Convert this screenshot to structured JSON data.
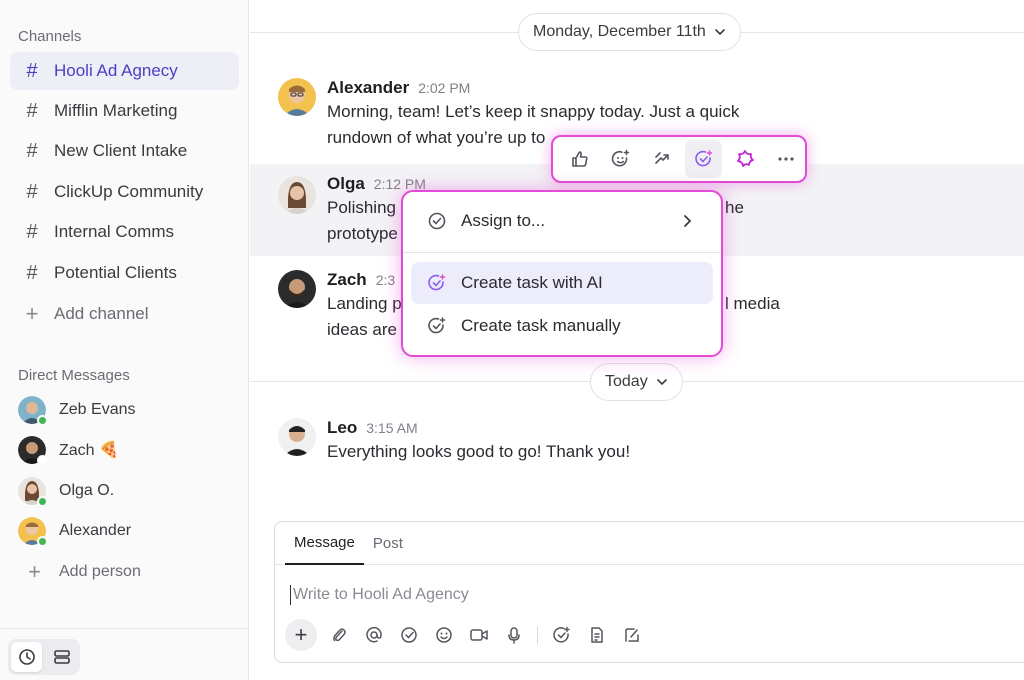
{
  "sidebar": {
    "channels_title": "Channels",
    "channels": [
      {
        "label": "Hooli Ad Agnecy",
        "active": true
      },
      {
        "label": "Mifflin Marketing"
      },
      {
        "label": "New Client Intake"
      },
      {
        "label": "ClickUp Community"
      },
      {
        "label": "Internal Comms"
      },
      {
        "label": "Potential Clients"
      }
    ],
    "add_channel": "Add channel",
    "dm_title": "Direct Messages",
    "dms": [
      {
        "label": "Zeb Evans"
      },
      {
        "label": "Zach 🍕"
      },
      {
        "label": "Olga O."
      },
      {
        "label": "Alexander"
      }
    ],
    "add_person": "Add person"
  },
  "main": {
    "date_divider": "Monday, December 11th",
    "today_divider": "Today",
    "messages": [
      {
        "author": "Alexander",
        "time": "2:02 PM",
        "line1": "Morning, team! Let’s keep it snappy today. Just a quick",
        "line2": "rundown of what you’re up to"
      },
      {
        "author": "Olga",
        "time": "2:12 PM",
        "line1": "Polishing",
        "line1_end": "he",
        "line2": "prototype"
      },
      {
        "author": "Zach",
        "time": "2:3",
        "line1": "Landing p",
        "line1_end": "l media",
        "line2": "ideas are"
      },
      {
        "author": "Leo",
        "time": "3:15 AM",
        "line1": "Everything looks good to go! Thank you!"
      }
    ]
  },
  "toolbar": {
    "icons": [
      "thumbs-up-icon",
      "add-reaction-icon",
      "convert-icon",
      "create-task-icon",
      "clickup-ai-icon",
      "more-icon"
    ],
    "accent": "#e24bd6"
  },
  "dropdown": {
    "assign": "Assign to...",
    "ai_task": "Create task with AI",
    "manual_task": "Create task manually"
  },
  "composer": {
    "tab_message": "Message",
    "tab_post": "Post",
    "placeholder": "Write to Hooli Ad Agency"
  },
  "colors": {
    "active_channel": "#4a3fc2",
    "online": "#3fb950",
    "highlight_border": "#e24bd6"
  }
}
